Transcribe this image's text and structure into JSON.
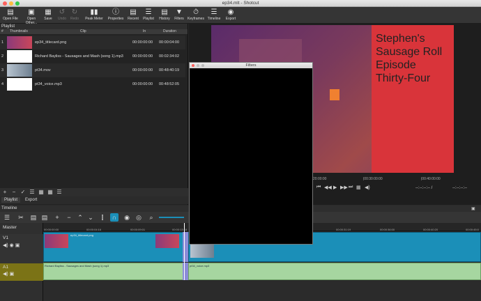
{
  "window": {
    "title": "ep34.mlt - Shotcut"
  },
  "toolbar": {
    "open_file": "Open File",
    "open_other": "Open Other...",
    "save": "Save",
    "undo": "Undo",
    "redo": "Redo",
    "peak_meter": "Peak Meter",
    "properties": "Properties",
    "recent": "Recent",
    "playlist": "Playlist",
    "history": "History",
    "filters": "Filters",
    "keyframes": "Keyframes",
    "timeline": "Timeline",
    "export": "Export"
  },
  "playlist": {
    "title": "Playlist",
    "columns": {
      "num": "#",
      "thumbnails": "Thumbnails",
      "clip": "Clip",
      "in": "In",
      "duration": "Duration"
    },
    "rows": [
      {
        "num": "1",
        "clip": "ep34_titlecard.png",
        "in": "00:00:00:00",
        "duration": "00:00:04:00"
      },
      {
        "num": "2",
        "clip": "Richard Bayliss - Sausages and Mash (song 1).mp3",
        "in": "00:00:00:00",
        "duration": "00:02:34:02"
      },
      {
        "num": "3",
        "clip": "pt34.mov",
        "in": "00:00:00:00",
        "duration": "00:48:40:19"
      },
      {
        "num": "4",
        "clip": "pt34_voice.mp3",
        "in": "00:00:00:00",
        "duration": "00:48:52:05"
      }
    ],
    "tabs": {
      "playlist": "Playlist",
      "export": "Export"
    }
  },
  "viewer": {
    "overlay_lines": [
      "Stephen's",
      "Sausage Roll",
      "Episode",
      "Thirty-Four"
    ],
    "ruler": [
      "20:00:00",
      "|00:30:00:00",
      "|00:40:00:00"
    ],
    "timecode_current": "--:--:--:-- /",
    "timecode_total": "--:--:--:--"
  },
  "filters_window": {
    "title": "Filters"
  },
  "timeline": {
    "title": "Timeline",
    "tracks": {
      "master": "Master",
      "v1": "V1",
      "a1": "A1"
    },
    "ruler": [
      "00:00:00:00",
      "00:00:04:16",
      "00:00:09:01",
      "00:00:13:18",
      "00:00:31:19",
      "00:00:36:00",
      "00:00:40:20",
      "00:00:45:0"
    ],
    "clips": {
      "titlecard": "ep34_titlecard.png",
      "song": "Richard Bayliss - Sausages and Mash (song 1).mp3",
      "voice": "pt34_voice.mp3"
    }
  },
  "colors": {
    "accent": "#1b8fb8",
    "audio": "#a6d6a0",
    "red": "#d9343a"
  }
}
